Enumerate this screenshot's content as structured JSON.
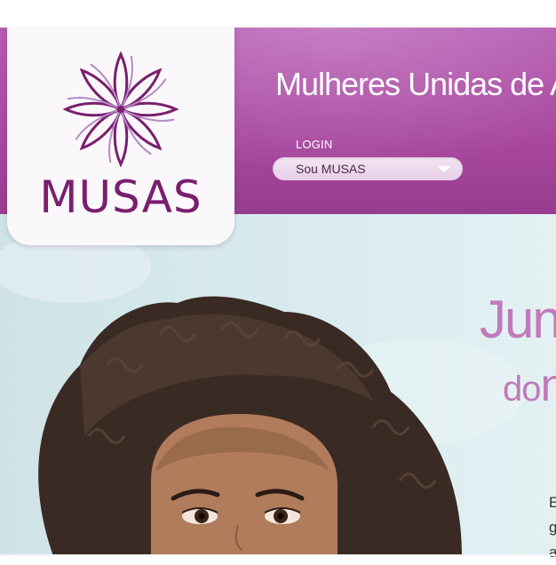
{
  "header": {
    "site_title": "Mulheres Unidas de At",
    "login_label": "LOGIN",
    "login_select_value": "Sou MUSAS"
  },
  "logo": {
    "brand": "MUSAS"
  },
  "hero": {
    "headline_1": "Junt",
    "headline_2_small": "do",
    "headline_2_big": "n",
    "paragraph_lines": [
      "E",
      "g",
      "a"
    ]
  },
  "colors": {
    "header_purple": "#a8489f",
    "logo_purple": "#7a1f6d",
    "hero_text": "#c07ab9",
    "hero_bg": "#d9ebee"
  }
}
